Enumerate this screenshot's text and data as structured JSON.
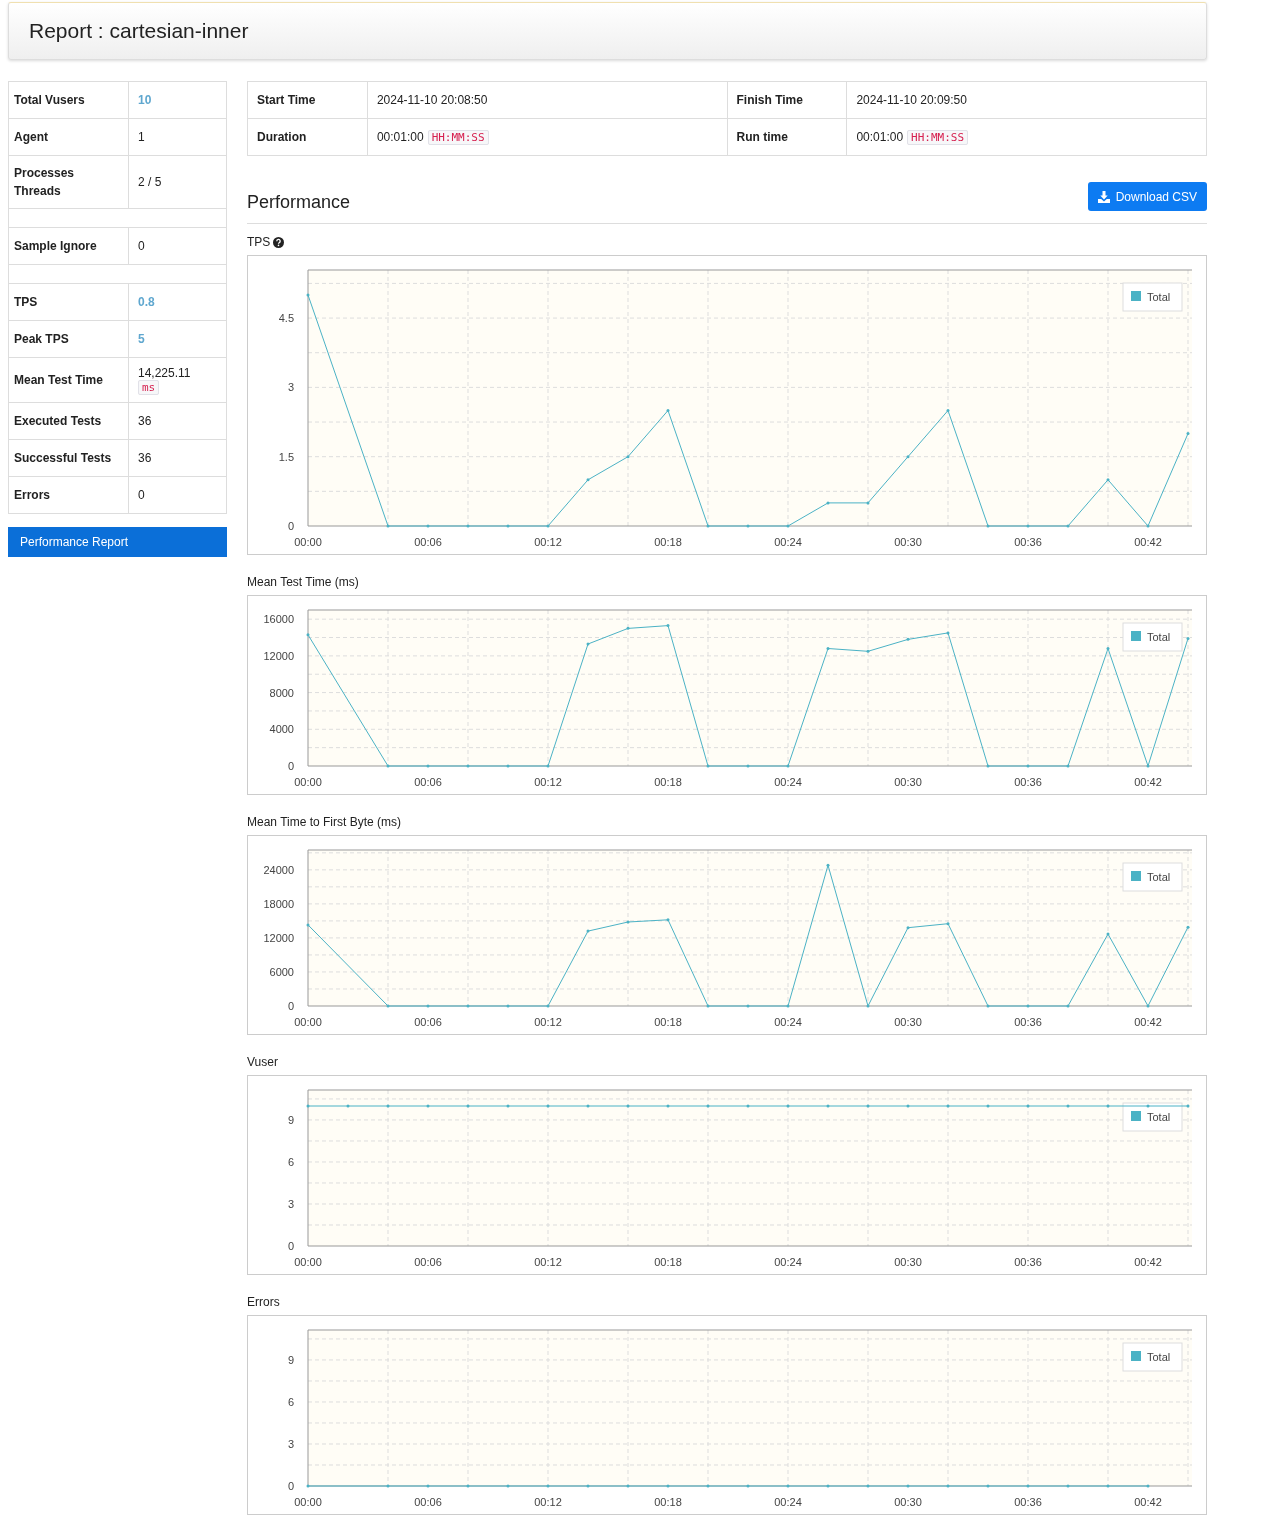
{
  "header": {
    "title": "Report : cartesian-inner"
  },
  "stats": [
    {
      "kind": "row",
      "label": "Total Vusers",
      "value": "10",
      "highlight": true
    },
    {
      "kind": "row",
      "label": "Agent",
      "value": "1",
      "highlight": false
    },
    {
      "kind": "row",
      "label": "Processes Threads",
      "value": "2 / 5",
      "highlight": false
    },
    {
      "kind": "spacer"
    },
    {
      "kind": "row",
      "label": "Sample Ignore",
      "value": "0",
      "highlight": false
    },
    {
      "kind": "spacer"
    },
    {
      "kind": "row",
      "label": "TPS",
      "value": "0.8",
      "highlight": true
    },
    {
      "kind": "row",
      "label": "Peak TPS",
      "value": "5",
      "highlight": true
    },
    {
      "kind": "row",
      "label": "Mean Test Time",
      "value": "14,225.11",
      "unit": "ms",
      "highlight": false
    },
    {
      "kind": "row",
      "label": "Executed Tests",
      "value": "36",
      "highlight": false
    },
    {
      "kind": "row",
      "label": "Successful Tests",
      "value": "36",
      "highlight": false
    },
    {
      "kind": "row",
      "label": "Errors",
      "value": "0",
      "highlight": false
    }
  ],
  "nav": [
    {
      "label": "Performance Report",
      "selected": true
    }
  ],
  "times": [
    [
      {
        "label": "Start Time",
        "value": "2024-11-10 20:08:50"
      },
      {
        "label": "Finish Time",
        "value": "2024-11-10 20:09:50"
      }
    ],
    [
      {
        "label": "Duration",
        "value": "00:01:00",
        "unit": "HH:MM:SS"
      },
      {
        "label": "Run time",
        "value": "00:01:00",
        "unit": "HH:MM:SS"
      }
    ]
  ],
  "performance": {
    "title": "Performance",
    "download_button": "Download CSV"
  },
  "charts": [
    {
      "title": "TPS",
      "help": true,
      "chart_data": {
        "type": "line",
        "grid": true,
        "x": [
          0,
          4,
          6,
          8,
          10,
          12,
          14,
          16,
          18,
          20,
          22,
          24,
          26,
          28,
          30,
          32,
          34,
          36,
          38,
          40,
          42,
          44
        ],
        "series": [
          {
            "name": "Total",
            "color": "#4bb2c5",
            "values": [
              5,
              0,
              0,
              0,
              0,
              0,
              1,
              1.5,
              2.5,
              0,
              0,
              0,
              0.5,
              0.5,
              1.5,
              2.5,
              0,
              0,
              0,
              1,
              0,
              2
            ]
          }
        ],
        "xlim": [
          0,
          44.2
        ],
        "ylim": [
          0,
          5.54
        ],
        "xticks": [
          {
            "value": 0,
            "label": "00:00"
          },
          {
            "value": 6,
            "label": "00:06"
          },
          {
            "value": 12,
            "label": "00:12"
          },
          {
            "value": 18,
            "label": "00:18"
          },
          {
            "value": 24,
            "label": "00:24"
          },
          {
            "value": 30,
            "label": "00:30"
          },
          {
            "value": 36,
            "label": "00:36"
          },
          {
            "value": 42,
            "label": "00:42"
          }
        ],
        "yticks": [
          0,
          1.5,
          3,
          4.5
        ]
      }
    },
    {
      "title": "Mean Test Time (ms)",
      "help": false,
      "chart_data": {
        "type": "line",
        "grid": true,
        "x": [
          0,
          4,
          6,
          8,
          10,
          12,
          14,
          16,
          18,
          20,
          22,
          24,
          26,
          28,
          30,
          32,
          34,
          36,
          38,
          40,
          42,
          44
        ],
        "series": [
          {
            "name": "Total",
            "color": "#4bb2c5",
            "values": [
              14300,
              0,
              0,
              0,
              0,
              0,
              13300,
              15000,
              15300,
              0,
              0,
              0,
              12800,
              12500,
              13800,
              14500,
              0,
              0,
              0,
              12800,
              0,
              13900
            ]
          }
        ],
        "xlim": [
          0,
          44.2
        ],
        "ylim": [
          0,
          17000
        ],
        "xticks": [
          {
            "value": 0,
            "label": "00:00"
          },
          {
            "value": 6,
            "label": "00:06"
          },
          {
            "value": 12,
            "label": "00:12"
          },
          {
            "value": 18,
            "label": "00:18"
          },
          {
            "value": 24,
            "label": "00:24"
          },
          {
            "value": 30,
            "label": "00:30"
          },
          {
            "value": 36,
            "label": "00:36"
          },
          {
            "value": 42,
            "label": "00:42"
          }
        ],
        "yticks": [
          0,
          4000,
          8000,
          12000,
          16000
        ]
      }
    },
    {
      "title": "Mean Time to First Byte (ms)",
      "help": false,
      "chart_data": {
        "type": "line",
        "grid": true,
        "x": [
          0,
          4,
          6,
          8,
          10,
          12,
          14,
          16,
          18,
          20,
          22,
          24,
          26,
          28,
          30,
          32,
          34,
          36,
          38,
          40,
          42,
          44
        ],
        "series": [
          {
            "name": "Total",
            "color": "#4bb2c5",
            "values": [
              14300,
              0,
              0,
              0,
              0,
              0,
              13200,
              14800,
              15200,
              0,
              0,
              0,
              24800,
              0,
              13800,
              14500,
              0,
              0,
              0,
              12700,
              0,
              13900
            ]
          }
        ],
        "xlim": [
          0,
          44.2
        ],
        "ylim": [
          0,
          27500
        ],
        "xticks": [
          {
            "value": 0,
            "label": "00:00"
          },
          {
            "value": 6,
            "label": "00:06"
          },
          {
            "value": 12,
            "label": "00:12"
          },
          {
            "value": 18,
            "label": "00:18"
          },
          {
            "value": 24,
            "label": "00:24"
          },
          {
            "value": 30,
            "label": "00:30"
          },
          {
            "value": 36,
            "label": "00:36"
          },
          {
            "value": 42,
            "label": "00:42"
          }
        ],
        "yticks": [
          0,
          6000,
          12000,
          18000,
          24000
        ]
      }
    },
    {
      "title": "Vuser",
      "help": false,
      "chart_data": {
        "type": "line",
        "grid": true,
        "x": [
          0,
          2,
          4,
          6,
          8,
          10,
          12,
          14,
          16,
          18,
          20,
          22,
          24,
          26,
          28,
          30,
          32,
          34,
          36,
          38,
          40,
          42,
          44
        ],
        "series": [
          {
            "name": "Total",
            "color": "#4bb2c5",
            "values": [
              10,
              10,
              10,
              10,
              10,
              10,
              10,
              10,
              10,
              10,
              10,
              10,
              10,
              10,
              10,
              10,
              10,
              10,
              10,
              10,
              10,
              10,
              10
            ]
          }
        ],
        "xlim": [
          0,
          44.2
        ],
        "ylim": [
          0,
          11.14
        ],
        "xticks": [
          {
            "value": 0,
            "label": "00:00"
          },
          {
            "value": 6,
            "label": "00:06"
          },
          {
            "value": 12,
            "label": "00:12"
          },
          {
            "value": 18,
            "label": "00:18"
          },
          {
            "value": 24,
            "label": "00:24"
          },
          {
            "value": 30,
            "label": "00:30"
          },
          {
            "value": 36,
            "label": "00:36"
          },
          {
            "value": 42,
            "label": "00:42"
          }
        ],
        "yticks": [
          0,
          3,
          6,
          9
        ]
      }
    },
    {
      "title": "Errors",
      "help": false,
      "chart_data": {
        "type": "line",
        "grid": true,
        "x": [
          0,
          4,
          6,
          8,
          10,
          12,
          14,
          16,
          18,
          20,
          22,
          24,
          26,
          28,
          30,
          32,
          34,
          36,
          38,
          40,
          42
        ],
        "series": [
          {
            "name": "Total",
            "color": "#4bb2c5",
            "values": [
              0,
              0,
              0,
              0,
              0,
              0,
              0,
              0,
              0,
              0,
              0,
              0,
              0,
              0,
              0,
              0,
              0,
              0,
              0,
              0,
              0
            ]
          }
        ],
        "xlim": [
          0,
          44.2
        ],
        "ylim": [
          0,
          11.14
        ],
        "xticks": [
          {
            "value": 0,
            "label": "00:00"
          },
          {
            "value": 6,
            "label": "00:06"
          },
          {
            "value": 12,
            "label": "00:12"
          },
          {
            "value": 18,
            "label": "00:18"
          },
          {
            "value": 24,
            "label": "00:24"
          },
          {
            "value": 30,
            "label": "00:30"
          },
          {
            "value": 36,
            "label": "00:36"
          },
          {
            "value": 42,
            "label": "00:42"
          }
        ],
        "yticks": [
          0,
          3,
          6,
          9
        ]
      }
    }
  ]
}
